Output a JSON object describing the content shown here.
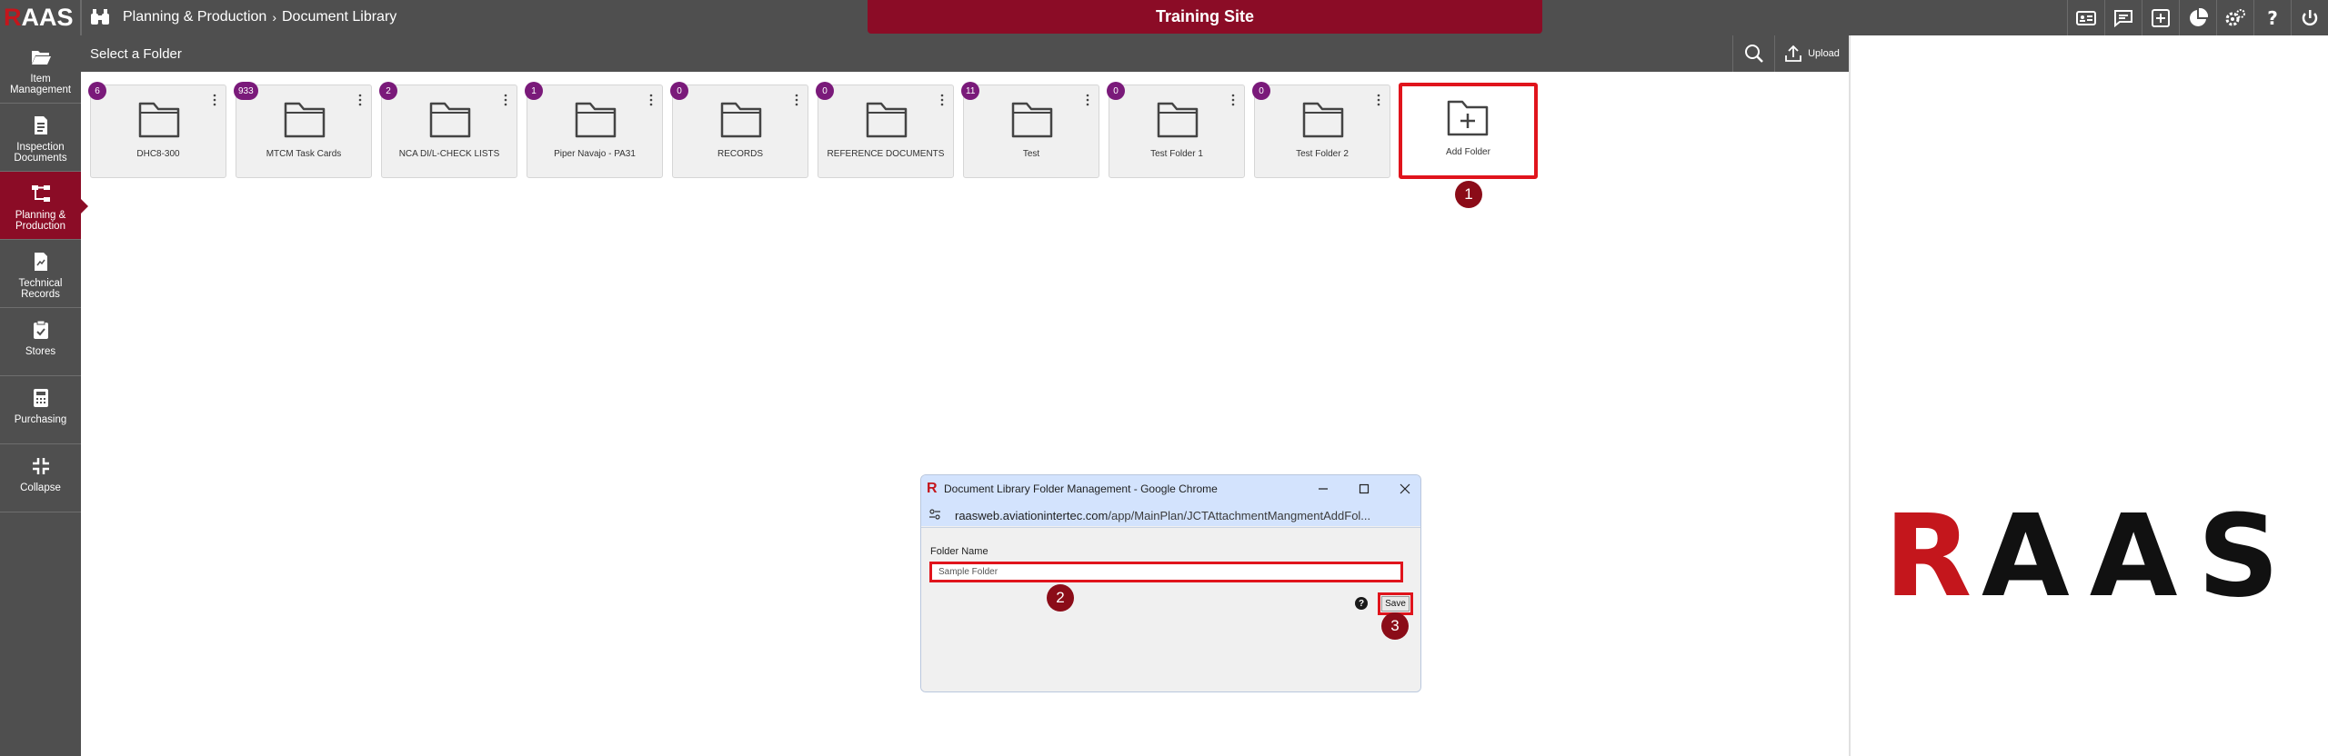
{
  "app": {
    "logo_r": "R",
    "logo_rest": "AAS",
    "breadcrumb": [
      "Planning & Production",
      "Document Library"
    ],
    "site_banner": "Training Site",
    "top_icons": [
      "id-card-icon",
      "chat-icon",
      "add-box-icon",
      "pie-chart-icon",
      "settings-icon",
      "help-icon",
      "power-icon"
    ]
  },
  "sidebar": {
    "items": [
      {
        "label": "Item Management",
        "icon": "folder-open-icon",
        "active": false
      },
      {
        "label": "Inspection Documents",
        "icon": "document-icon",
        "active": false
      },
      {
        "label": "Planning & Production",
        "icon": "flow-chart-icon",
        "active": true
      },
      {
        "label": "Technical Records",
        "icon": "records-icon",
        "active": false
      },
      {
        "label": "Stores",
        "icon": "clipboard-icon",
        "active": false
      },
      {
        "label": "Purchasing",
        "icon": "calculator-icon",
        "active": false
      },
      {
        "label": "Collapse",
        "icon": "collapse-icon",
        "active": false
      }
    ]
  },
  "toolbar": {
    "title": "Select a Folder",
    "upload_label": "Upload"
  },
  "folders": [
    {
      "name": "DHC8-300",
      "count": "6"
    },
    {
      "name": "MTCM Task Cards",
      "count": "933"
    },
    {
      "name": "NCA DI/L-CHECK LISTS",
      "count": "2"
    },
    {
      "name": "Piper Navajo - PA31",
      "count": "1"
    },
    {
      "name": "RECORDS",
      "count": "0"
    },
    {
      "name": "REFERENCE DOCUMENTS",
      "count": "0"
    },
    {
      "name": "Test",
      "count": "11"
    },
    {
      "name": "Test Folder 1",
      "count": "0"
    },
    {
      "name": "Test Folder 2",
      "count": "0"
    }
  ],
  "add_folder": {
    "label": "Add Folder"
  },
  "markers": [
    "1",
    "2",
    "3"
  ],
  "dialog": {
    "title": "Document Library Folder Management - Google Chrome",
    "url_domain": "raasweb.aviationintertec.com",
    "url_path": "/app/MainPlan/JCTAttachmentMangmentAddFol...",
    "field_label": "Folder Name",
    "field_value": "Sample Folder",
    "help_glyph": "?",
    "save_label": "Save"
  },
  "brand_logo": {
    "text": "RAAS"
  },
  "colors": {
    "chrome_gray": "#4f4f4f",
    "accent_maroon": "#8b0c26",
    "highlight_red": "#e0141c",
    "badge_purple": "#7a1a7a"
  }
}
